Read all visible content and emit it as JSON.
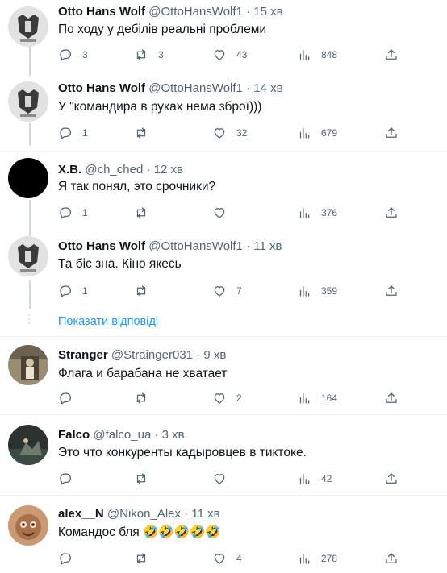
{
  "tweets": [
    {
      "name": "Otto Hans Wolf",
      "handle": "@OttoHansWolf1",
      "time": "15 хв",
      "text": "По ходу у дебілів реальні проблеми",
      "replies": "3",
      "retweets": "3",
      "likes": "43",
      "views": "848"
    },
    {
      "name": "Otto Hans Wolf",
      "handle": "@OttoHansWolf1",
      "time": "14 хв",
      "text": "У \"командира в руках нема зброї)))",
      "replies": "1",
      "retweets": "",
      "likes": "32",
      "views": "679"
    },
    {
      "name": "X.B.",
      "handle": "@ch_ched",
      "time": "12 хв",
      "text": "Я так понял, это срочники?",
      "replies": "1",
      "retweets": "",
      "likes": "",
      "views": "376"
    },
    {
      "name": "Otto Hans Wolf",
      "handle": "@OttoHansWolf1",
      "time": "11 хв",
      "text": "Та біс зна. Кіно якесь",
      "replies": "1",
      "retweets": "",
      "likes": "7",
      "views": "359"
    },
    {
      "name": "Stranger",
      "handle": "@Strainger031",
      "time": "9 хв",
      "text": "Флага и барабана не хватает",
      "replies": "",
      "retweets": "",
      "likes": "2",
      "views": "164"
    },
    {
      "name": "Falco",
      "handle": "@falco_ua",
      "time": "3 хв",
      "text": "Это что конкуренты кадыровцев в тиктоке.",
      "replies": "",
      "retweets": "",
      "likes": "",
      "views": "42"
    },
    {
      "name": "alex__N",
      "handle": "@Nikon_Alex",
      "time": "11 хв",
      "text": "Командос бля 🤣🤣🤣🤣🤣",
      "replies": "",
      "retweets": "",
      "likes": "4",
      "views": "278"
    }
  ],
  "show_replies_label": "Показати відповіді",
  "separator": "·",
  "colors": {
    "accent": "#1d9bf0",
    "muted": "#536471",
    "text": "#0f1419",
    "line": "#cfd9de"
  },
  "icons": [
    "reply-icon",
    "retweet-icon",
    "like-icon",
    "views-icon",
    "share-icon"
  ]
}
